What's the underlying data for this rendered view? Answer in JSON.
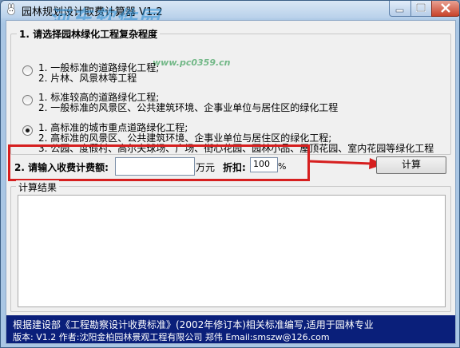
{
  "window": {
    "title": "园林规划设计取费计算器 V1.2"
  },
  "watermark": {
    "text": "河东软件园",
    "sub": "www.pc0359.cn"
  },
  "group1": {
    "legend": "1. 请选择园林绿化工程复杂程度",
    "options": [
      {
        "lines": [
          "1. 一般标准的道路绿化工程;",
          "2. 片林、风景林等工程"
        ],
        "checked": false
      },
      {
        "lines": [
          "1. 标准较高的道路绿化工程;",
          "2. 一般标准的风景区、公共建筑环境、企事业单位与居住区的绿化工程"
        ],
        "checked": false
      },
      {
        "lines": [
          "1. 高标准的城市重点道路绿化工程;",
          "2. 高标准的风景区、公共建筑环境、企事业单位与居住区的绿化工程;",
          "3. 公园、度假村、高尔夫球场、广场、街心花园、园林小品、屋顶花园、室内花园等绿化工程"
        ],
        "checked": true
      }
    ]
  },
  "fee": {
    "label": "2. 请输入收费计费额:",
    "value": "",
    "unit": "万元",
    "discount_label": "折扣:",
    "discount_value": "100",
    "percent": "%",
    "calc_label": "计算"
  },
  "result": {
    "legend": "计算结果",
    "text": ""
  },
  "footer": {
    "line1": "根据建设部《工程勘察设计收费标准》(2002年修订本)相关标准编写,适用于园林专业",
    "line2": "版本: V1.2  作者:沈阳金柏园林景观工程有限公司 郑伟 Email:smszw@126.com"
  },
  "colors": {
    "highlight": "#d61f1f",
    "footer_bg": "#0a1f7a",
    "title_bg": "#b8d0ea"
  }
}
